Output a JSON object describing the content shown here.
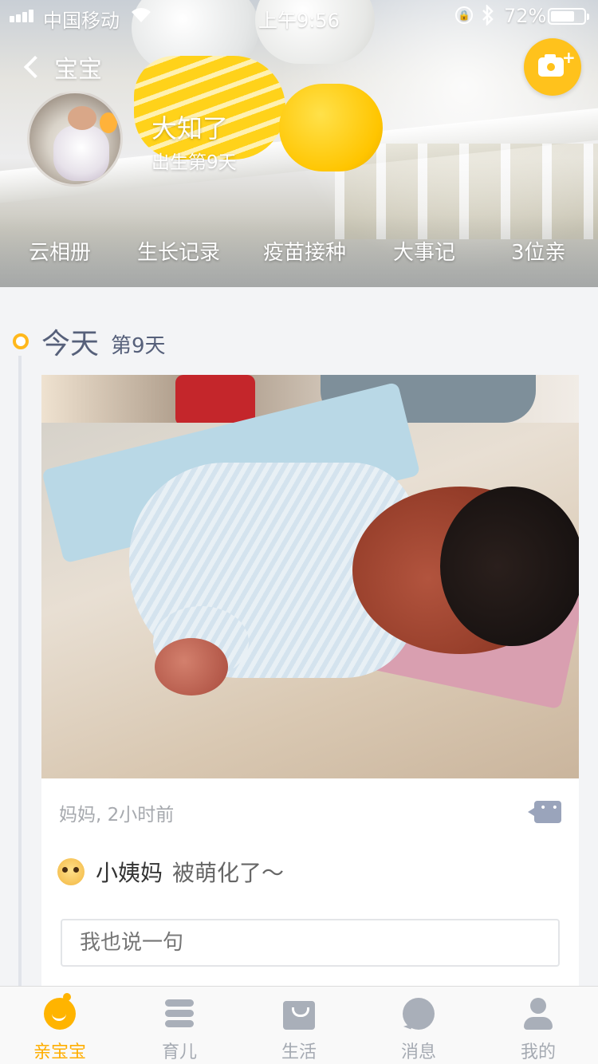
{
  "status_bar": {
    "carrier": "中国移动",
    "time": "上午9:56",
    "battery_percent": "72%",
    "battery_level": 0.72
  },
  "nav": {
    "back_label": "宝宝"
  },
  "profile": {
    "name": "大知了",
    "age_text": "出生第9天"
  },
  "header_tabs": [
    {
      "label": "云相册"
    },
    {
      "label": "生长记录"
    },
    {
      "label": "疫苗接种"
    },
    {
      "label": "大事记"
    },
    {
      "label": "3位亲"
    }
  ],
  "timeline": {
    "day_title": "今天",
    "day_number": "第9天"
  },
  "post": {
    "meta": "妈妈, 2小时前",
    "comments": [
      {
        "user": "小姨妈",
        "text": "被萌化了～"
      }
    ],
    "reply_placeholder": "我也说一句"
  },
  "tabbar": {
    "items": [
      {
        "label": "亲宝宝",
        "icon": "baby-face-icon",
        "active": true
      },
      {
        "label": "育儿",
        "icon": "list-icon",
        "active": false
      },
      {
        "label": "生活",
        "icon": "shopping-bag-icon",
        "active": false
      },
      {
        "label": "消息",
        "icon": "chat-bubble-icon",
        "active": false
      },
      {
        "label": "我的",
        "icon": "user-icon",
        "active": false
      }
    ]
  },
  "colors": {
    "accent": "#ffb400",
    "timeline_text": "#56607a",
    "inactive_tab": "#a5aab2"
  }
}
